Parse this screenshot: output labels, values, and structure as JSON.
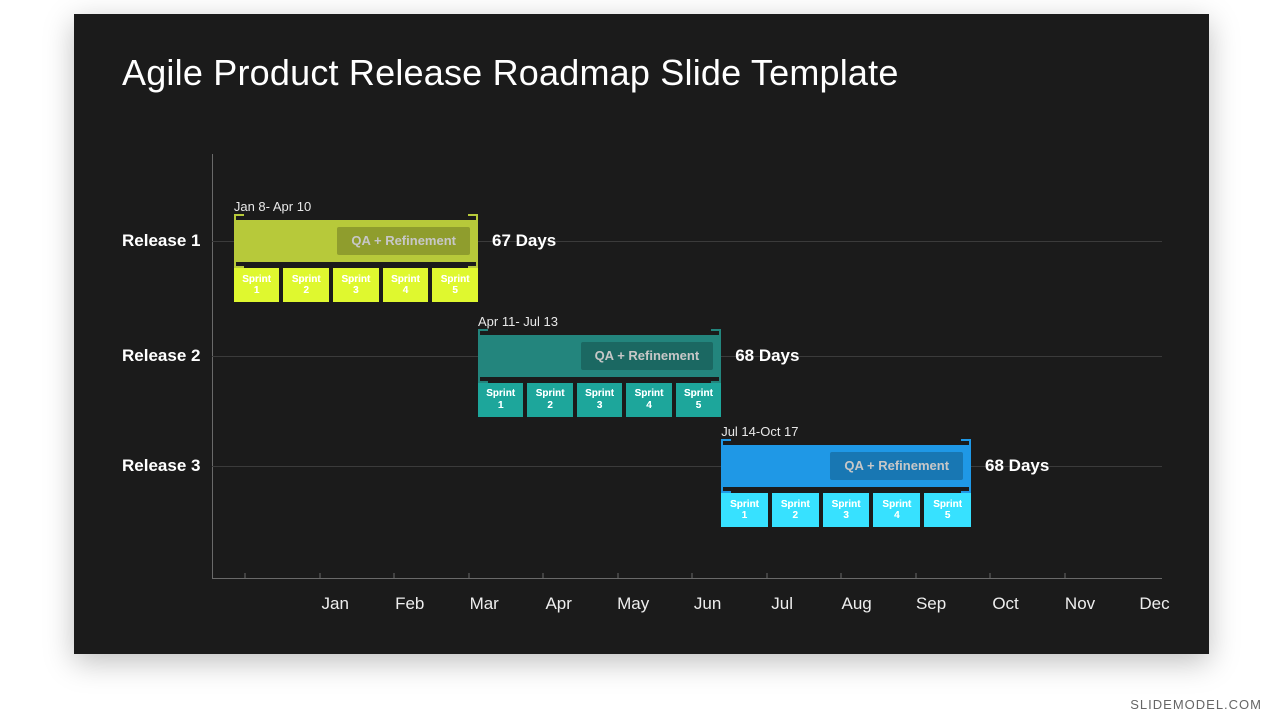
{
  "title": "Agile Product Release Roadmap Slide Template",
  "attribution": "SLIDEMODEL.COM",
  "colors": {
    "release1": "#b7c93a",
    "release2": "#23857d",
    "release3": "#1f98e6",
    "sprint3": "#3cb5f2"
  },
  "chart_data": {
    "type": "bar",
    "title": "Agile Product Release Roadmap Slide Template",
    "xlabel": "",
    "ylabel": "",
    "x_ticks": [
      "Jan",
      "Feb",
      "Mar",
      "Apr",
      "May",
      "Jun",
      "Jul",
      "Aug",
      "Sep",
      "Oct",
      "Nov",
      "Dec"
    ],
    "categories": [
      "Release 1",
      "Release 2",
      "Release 3"
    ],
    "series": [
      {
        "name": "Release 1",
        "date_range": "Jan 8- Apr 10",
        "duration_label": "67 Days",
        "start_month_pct": 2.3,
        "end_month_pct": 28.0,
        "qa_label": "QA + Refinement",
        "color_key": "release1",
        "sprints": [
          "Sprint 1",
          "Sprint 2",
          "Sprint 3",
          "Sprint 4",
          "Sprint 5"
        ]
      },
      {
        "name": "Release 2",
        "date_range": "Apr 11- Jul 13",
        "duration_label": "68 Days",
        "start_month_pct": 28.0,
        "end_month_pct": 53.6,
        "qa_label": "QA + Refinement",
        "color_key": "release2",
        "sprints": [
          "Sprint 1",
          "Sprint 2",
          "Sprint 3",
          "Sprint 4",
          "Sprint 5"
        ]
      },
      {
        "name": "Release 3",
        "date_range": "Jul 14-Oct 17",
        "duration_label": "68 Days",
        "start_month_pct": 53.6,
        "end_month_pct": 79.9,
        "qa_label": "QA + Refinement",
        "color_key": "release3",
        "sprint_color_key": "sprint3",
        "sprints": [
          "Sprint 1",
          "Sprint 2",
          "Sprint 3",
          "Sprint 4",
          "Sprint 5"
        ]
      }
    ],
    "row_y_ratio": [
      0.205,
      0.475,
      0.735
    ],
    "tick_step_ratio": 0.0784,
    "tick_start_ratio": 0.035
  }
}
